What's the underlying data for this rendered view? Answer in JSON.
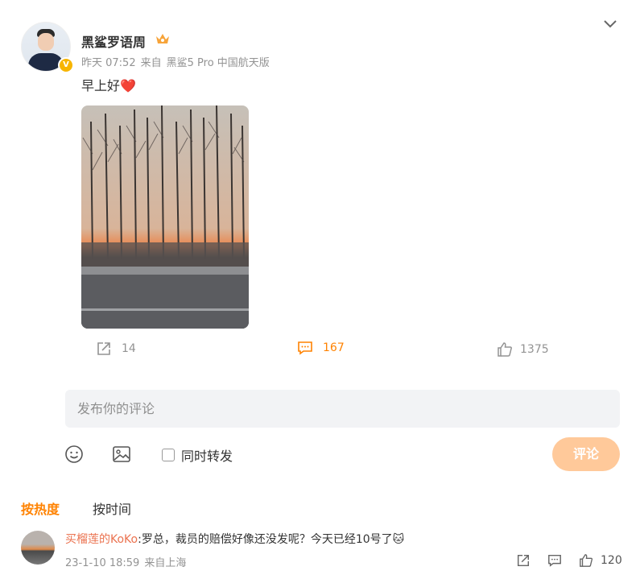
{
  "post": {
    "author": "黑鲨罗语周",
    "verified_badge": "V",
    "time": "昨天 07:52",
    "source_prefix": "来自",
    "source": "黑鲨5 Pro 中国航天版",
    "text": "早上好",
    "heart": "❤️"
  },
  "actions": {
    "share_count": "14",
    "comment_count": "167",
    "like_count": "1375"
  },
  "composer": {
    "placeholder": "发布你的评论",
    "repost_label": "同时转发",
    "submit_label": "评论"
  },
  "tabs": {
    "hot": "按热度",
    "time": "按时间"
  },
  "comment": {
    "user": "买榴莲的KoKo",
    "text": ":罗总，裁员的赔偿好像还没发呢？今天已经10号了",
    "emoji": "🐱",
    "date": "23-1-10 18:59",
    "location": "来自上海",
    "like_count": "120"
  },
  "colors": {
    "accent": "#ff8200",
    "username_link": "#eb7350",
    "submit_disabled": "#ffc99a"
  }
}
